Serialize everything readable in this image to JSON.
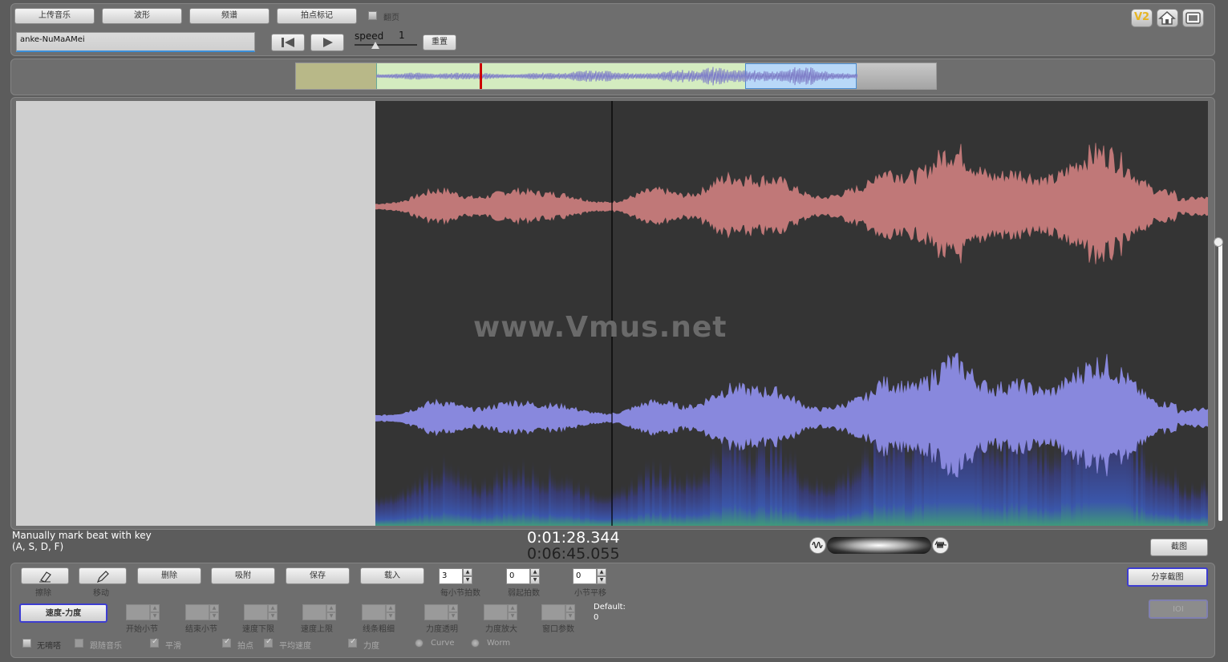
{
  "toolbar": {
    "upload_label": "上传音乐",
    "waveform_label": "波形",
    "spectrum_label": "频谱",
    "beat_mark_label": "拍点标记",
    "flip_page_label": "翻页",
    "song_title": "anke-NuMaAMei",
    "speed_label": "speed",
    "speed_value": "1",
    "reset_label": "重置"
  },
  "corner_icons": {
    "v2_label": "V2",
    "home_icon": "home-icon",
    "fullscreen_icon": "screen-icon"
  },
  "colors": {
    "waveform_top": "#c07878",
    "waveform_bottom": "#8888dd",
    "overview_played": "#b8b888",
    "overview_body": "#d4ecc0",
    "overview_selection": "#b8d8f8",
    "playhead": "#cc0000"
  },
  "playback": {
    "played_fraction": 0.2264
  },
  "canvas": {
    "watermark": "www.Vmus.net"
  },
  "status": {
    "hint_line1": "Manually mark beat with key",
    "hint_line2": "(A, S, D, F)",
    "current_time": "0:01:28.344",
    "total_time": "0:06:45.055",
    "screenshot_label": "截图"
  },
  "tools": {
    "erase_label": "擦除",
    "move_label": "移动",
    "delete_label": "删除",
    "snap_label": "吸附",
    "save_label": "保存",
    "load_label": "载入",
    "beats_per_bar_value": "3",
    "beats_per_bar_label": "每小节拍数",
    "pickup_value": "0",
    "pickup_label": "弱起拍数",
    "bar_shift_value": "0",
    "bar_shift_label": "小节平移",
    "share_label": "分享截图",
    "io_label": "IOI",
    "tempo_dynamics_label": "速度-力度",
    "start_bar_label": "开始小节",
    "end_bar_label": "结束小节",
    "tempo_lower_label": "速度下限",
    "tempo_upper_label": "速度上限",
    "line_width_label": "线条粗细",
    "dynamics_opacity_label": "力度透明",
    "dynamics_zoom_label": "力度放大",
    "window_param_label": "窗口参数",
    "default_label": "Default:",
    "default_value": "0",
    "no_click_label": "无嘀嗒",
    "follow_music_label": "跟随音乐",
    "smooth_label": "平滑",
    "beat_label": "拍点",
    "avg_tempo_label": "平均速度",
    "dynamics_label": "力度",
    "curve_label": "Curve",
    "worm_label": "Worm"
  }
}
